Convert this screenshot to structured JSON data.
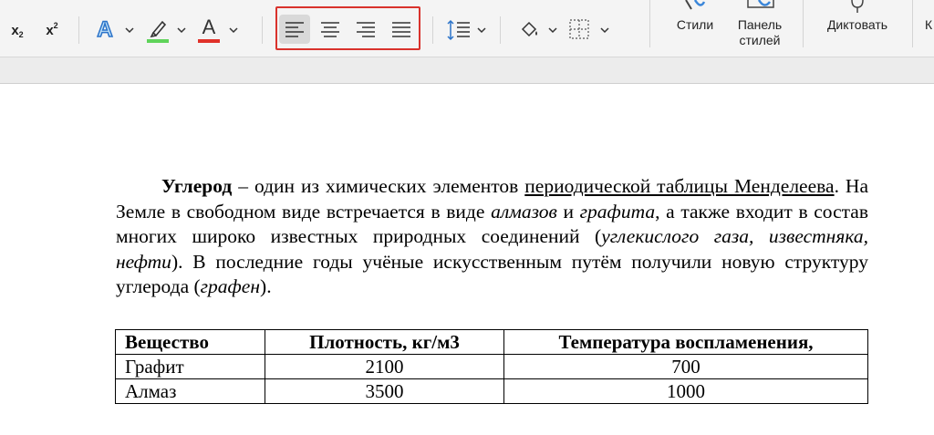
{
  "ribbon": {
    "subscript_label": "x",
    "subscript_suffix": "2",
    "superscript_label": "x",
    "superscript_suffix": "2",
    "text_effects_letter": "A",
    "font_color_letter": "A",
    "styles_label": "Стили",
    "styles_pane_label": "Панель стилей",
    "dictate_label": "Диктовать",
    "highlight_color": "#5fd35a",
    "font_color": "#e0312a",
    "alignment_selected": "align-left",
    "align_group_highlight_color": "#d9322c"
  },
  "document": {
    "paragraph": {
      "p1_bold": "Углерод",
      "p2": " – один из химических элементов ",
      "p3_link": "периодической таблицы Менделеева",
      "p4": ". На Земле в свободном виде встречается в виде ",
      "p5_italic": "алмазов",
      "p6": " и ",
      "p7_italic": "графита",
      "p8": ", а также входит в состав многих широко известных природных соединений (",
      "p9_italic": "углекислого газа, известняка, нефти",
      "p10": "). В последние годы учёные искусственным путём получили новую структуру углерода (",
      "p11_italic": "графен",
      "p12": ")."
    },
    "table": {
      "headers": [
        "Вещество",
        "Плотность, кг/м3",
        "Температура воспламенения,"
      ],
      "rows": [
        [
          "Графит",
          "2100",
          "700"
        ],
        [
          "Алмаз",
          "3500",
          "1000"
        ]
      ]
    }
  }
}
